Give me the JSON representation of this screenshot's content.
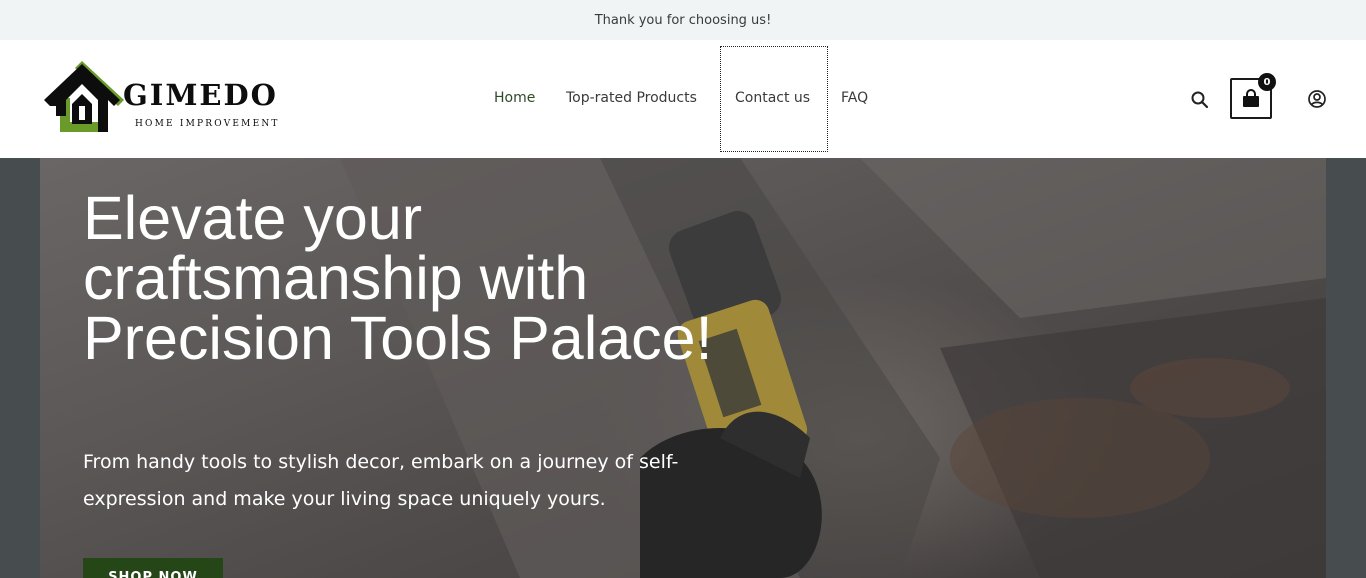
{
  "announcement": {
    "text": "Thank you for choosing us!"
  },
  "logo": {
    "brand": "GIMEDO",
    "tagline": "HOME IMPROVEMENT"
  },
  "nav": {
    "items": [
      {
        "label": "Home"
      },
      {
        "label": "Top-rated Products"
      },
      {
        "label": "Contact us"
      },
      {
        "label": "FAQ"
      }
    ]
  },
  "header_actions": {
    "search_icon": "search-icon",
    "cart_icon": "shopping-bag-icon",
    "cart_count": "0",
    "account_icon": "user-circle-icon"
  },
  "hero": {
    "title": "Elevate your craftsmanship with Precision Tools Palace!",
    "subtitle": "From handy tools to stylish decor, embark on a journey of self-expression and make your living space uniquely yours.",
    "cta_label": "SHOP NOW"
  },
  "colors": {
    "accent_green": "#254617",
    "logo_green": "#6a9a2a",
    "topbar_bg": "#f1f4f5"
  }
}
